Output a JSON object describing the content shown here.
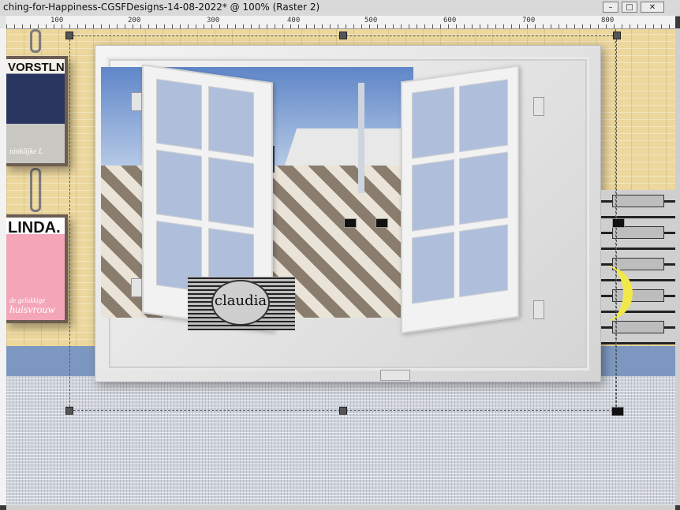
{
  "window": {
    "title": "ching-for-Happiness-CGSFDesigns-14-08-2022* @ 100% (Raster 2)",
    "controls": {
      "minimize": "–",
      "maximize": "□",
      "close": "✕"
    }
  },
  "ruler": {
    "labels": [
      "100",
      "200",
      "300",
      "400",
      "500",
      "600",
      "700",
      "800"
    ]
  },
  "canvas": {
    "magazines": [
      {
        "title": "VORSTLN",
        "subtitle": "ninklijke L"
      },
      {
        "title": "LINDA.",
        "subtitle": "huisvrouw",
        "tag": "de gelukkige"
      }
    ],
    "watermark_text": "claudia"
  },
  "colors": {
    "wall": "#ecd79d",
    "floor": "#cfd3da",
    "accent_blue": "#7d98c0",
    "guide_red": "#c0392b"
  }
}
